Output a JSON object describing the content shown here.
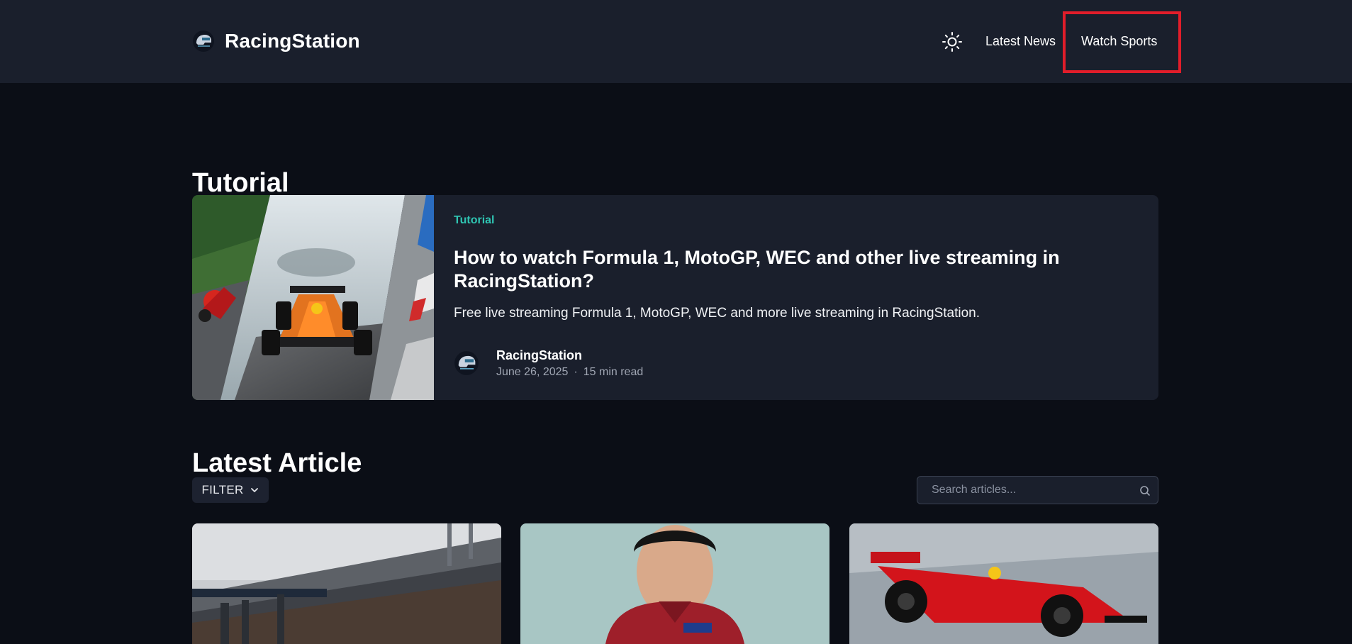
{
  "header": {
    "brand_name": "RacingStation",
    "nav": {
      "latest_news": "Latest News",
      "watch_sports": "Watch Sports"
    },
    "highlight_color": "#e11d2a"
  },
  "tutorial_section": {
    "title": "Tutorial",
    "featured": {
      "category": "Tutorial",
      "title": "How to watch Formula 1, MotoGP, WEC and other live streaming in RacingStation?",
      "description": "Free live streaming Formula 1, MotoGP, WEC and more live streaming in RacingStation.",
      "author": "RacingStation",
      "date": "June 26, 2025",
      "separator": "·",
      "read_time": "15 min read"
    }
  },
  "latest_section": {
    "title": "Latest Article",
    "filter_label": "FILTER",
    "search_placeholder": "Search articles..."
  },
  "colors": {
    "page_bg": "#0b0e16",
    "header_bg": "#1a1f2c",
    "card_bg": "#1a1f2c",
    "accent_teal": "#2fc4b2"
  },
  "icons": {
    "theme_toggle": "sun-icon",
    "filter": "chevron-down-icon",
    "search": "search-icon",
    "logo": "helmet-logo"
  }
}
